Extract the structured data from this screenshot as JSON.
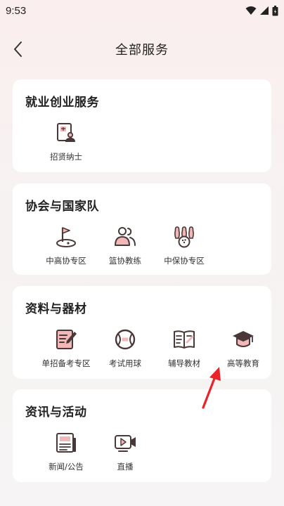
{
  "status_bar": {
    "time": "9:53"
  },
  "header": {
    "title": "全部服务"
  },
  "sections": [
    {
      "title": "就业创业服务",
      "items": [
        {
          "label": "招贤纳士",
          "icon": "recruitment-icon"
        }
      ]
    },
    {
      "title": "协会与国家队",
      "items": [
        {
          "label": "中高协专区",
          "icon": "golf-flag-icon"
        },
        {
          "label": "篮协教练",
          "icon": "group-users-icon"
        },
        {
          "label": "中保协专区",
          "icon": "bowling-icon"
        }
      ]
    },
    {
      "title": "资料与器材",
      "items": [
        {
          "label": "单招备考专区",
          "icon": "exam-edit-icon"
        },
        {
          "label": "考试用球",
          "icon": "ball-icon"
        },
        {
          "label": "辅导教材",
          "icon": "textbook-icon"
        },
        {
          "label": "高等教育",
          "icon": "graduation-cap-icon"
        }
      ]
    },
    {
      "title": "资讯与活动",
      "items": [
        {
          "label": "新闻/公告",
          "icon": "news-icon"
        },
        {
          "label": "直播",
          "icon": "live-video-icon"
        }
      ]
    }
  ],
  "colors": {
    "icon_dark": "#4a3838",
    "icon_accent": "#f2b8b8",
    "annotation_arrow": "#e8262a"
  }
}
